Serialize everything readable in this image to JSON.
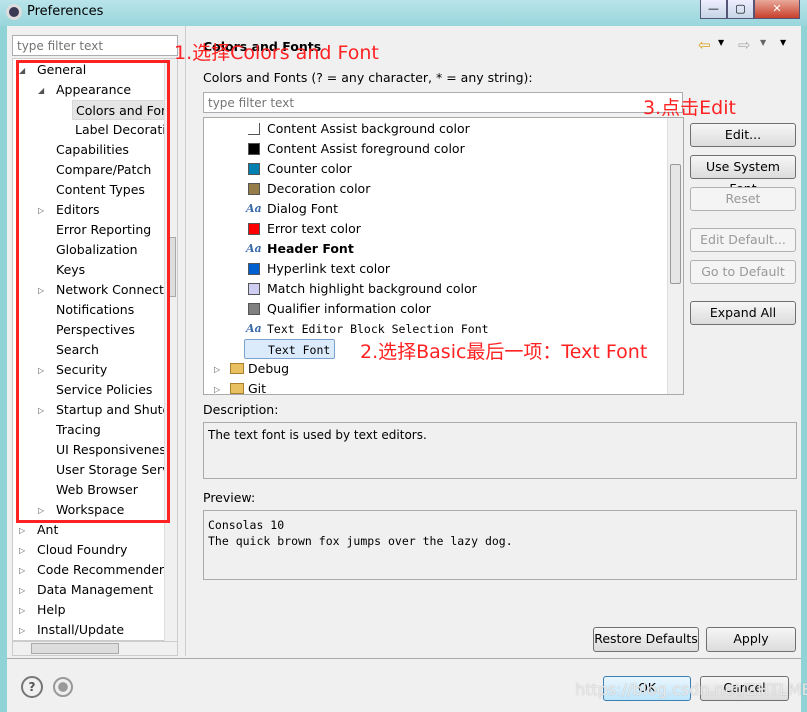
{
  "window": {
    "title": "Preferences",
    "min": "—",
    "max": "▢",
    "close": "✕"
  },
  "left": {
    "filter_placeholder": "type filter text",
    "tree": [
      {
        "label": "General",
        "level": 0,
        "state": "expanded"
      },
      {
        "label": "Appearance",
        "level": 1,
        "state": "expanded"
      },
      {
        "label": "Colors and Fonts",
        "level": 2,
        "state": "selected"
      },
      {
        "label": "Label Decorations",
        "level": 2,
        "state": "leaf"
      },
      {
        "label": "Capabilities",
        "level": 1,
        "state": "leaf"
      },
      {
        "label": "Compare/Patch",
        "level": 1,
        "state": "leaf"
      },
      {
        "label": "Content Types",
        "level": 1,
        "state": "leaf"
      },
      {
        "label": "Editors",
        "level": 1,
        "state": "collapsed"
      },
      {
        "label": "Error Reporting",
        "level": 1,
        "state": "leaf"
      },
      {
        "label": "Globalization",
        "level": 1,
        "state": "leaf"
      },
      {
        "label": "Keys",
        "level": 1,
        "state": "leaf"
      },
      {
        "label": "Network Connections",
        "level": 1,
        "state": "collapsed"
      },
      {
        "label": "Notifications",
        "level": 1,
        "state": "leaf"
      },
      {
        "label": "Perspectives",
        "level": 1,
        "state": "leaf"
      },
      {
        "label": "Search",
        "level": 1,
        "state": "leaf"
      },
      {
        "label": "Security",
        "level": 1,
        "state": "collapsed"
      },
      {
        "label": "Service Policies",
        "level": 1,
        "state": "leaf"
      },
      {
        "label": "Startup and Shutdown",
        "level": 1,
        "state": "collapsed"
      },
      {
        "label": "Tracing",
        "level": 1,
        "state": "leaf"
      },
      {
        "label": "UI Responsiveness",
        "level": 1,
        "state": "leaf"
      },
      {
        "label": "User Storage Service",
        "level": 1,
        "state": "leaf"
      },
      {
        "label": "Web Browser",
        "level": 1,
        "state": "leaf"
      },
      {
        "label": "Workspace",
        "level": 1,
        "state": "collapsed"
      },
      {
        "label": "Ant",
        "level": 0,
        "state": "collapsed"
      },
      {
        "label": "Cloud Foundry",
        "level": 0,
        "state": "collapsed"
      },
      {
        "label": "Code Recommenders",
        "level": 0,
        "state": "collapsed"
      },
      {
        "label": "Data Management",
        "level": 0,
        "state": "collapsed"
      },
      {
        "label": "Help",
        "level": 0,
        "state": "collapsed"
      },
      {
        "label": "Install/Update",
        "level": 0,
        "state": "collapsed"
      }
    ]
  },
  "right": {
    "title": "Colors and Fonts",
    "label": "Colors and Fonts (? = any character, * = any string):",
    "filter_placeholder": "type filter text",
    "items": [
      {
        "label": "Content Assist background color",
        "kind": "color",
        "color": "#ffffff"
      },
      {
        "label": "Content Assist foreground color",
        "kind": "color",
        "color": "#000000"
      },
      {
        "label": "Counter color",
        "kind": "color",
        "color": "#0080b0"
      },
      {
        "label": "Decoration color",
        "kind": "color",
        "color": "#957c48"
      },
      {
        "label": "Dialog Font",
        "kind": "font"
      },
      {
        "label": "Error text color",
        "kind": "color",
        "color": "#ff0000"
      },
      {
        "label": "Header Font",
        "kind": "font",
        "bold": true
      },
      {
        "label": "Hyperlink text color",
        "kind": "color",
        "color": "#0060d0"
      },
      {
        "label": "Match highlight background color",
        "kind": "color",
        "color": "#cfcdf2"
      },
      {
        "label": "Qualifier information color",
        "kind": "color",
        "color": "#808080"
      },
      {
        "label": "Text Editor Block Selection Font",
        "kind": "font",
        "mono": true
      },
      {
        "label": "Text Font",
        "kind": "font",
        "mono": true,
        "selected": true
      }
    ],
    "groups": [
      "Debug",
      "Git"
    ],
    "font_icon": "Aa",
    "buttons": {
      "edit": "Edit...",
      "use_system": "Use System Font",
      "reset": "Reset",
      "edit_default": "Edit Default...",
      "goto_default": "Go to Default",
      "expand_all": "Expand All"
    },
    "description_label": "Description:",
    "description": "The text font is used by text editors.",
    "preview_label": "Preview:",
    "preview_line1": "Consolas 10",
    "preview_line2": "The quick brown fox jumps over the lazy dog.",
    "restore": "Restore Defaults",
    "apply": "Apply"
  },
  "footer": {
    "ok": "OK",
    "cancel": "Cancel"
  },
  "annotations": {
    "a1": "1.选择Colors and Font",
    "a2": "2.选择Basic最后一项：Text Font",
    "a3": "3.点击Edit",
    "color": "#ff2020"
  },
  "watermark": "https://blog.csdn.net/ZHTLMBC"
}
